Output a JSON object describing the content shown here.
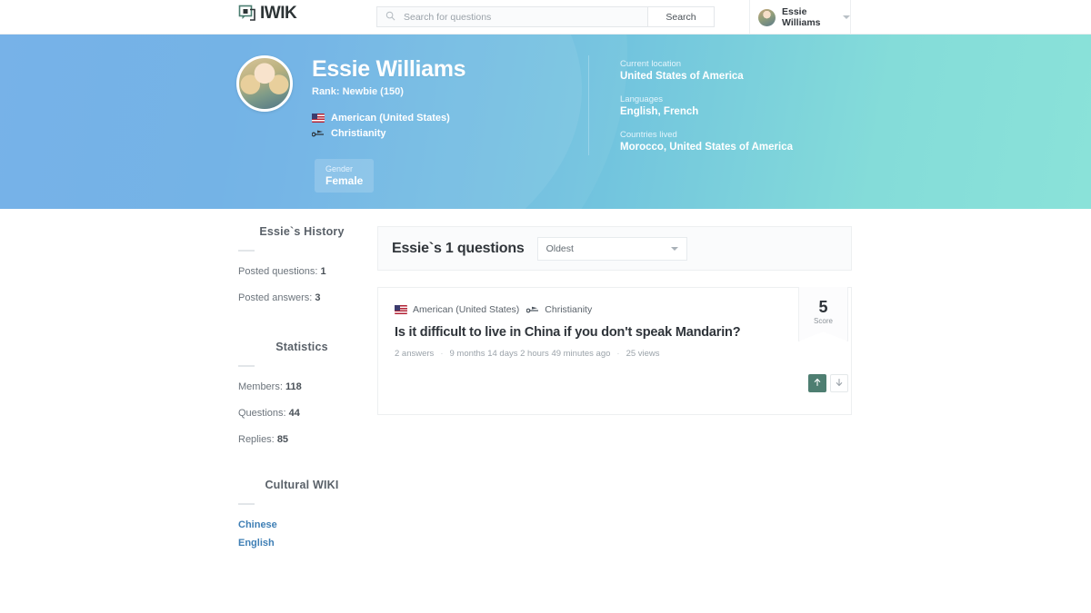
{
  "header": {
    "logo_text": "IWIK",
    "logo_icon": "speech-bubble-icon",
    "search_placeholder": "Search for questions",
    "search_value": "",
    "search_button": "Search",
    "search_icon": "search-icon",
    "user_name": "Essie Williams",
    "user_caret": "chevron-down-icon"
  },
  "hero": {
    "name": "Essie Williams",
    "rank": "Rank: Newbie (150)",
    "nationality": "American (United States)",
    "nationality_icon": "us-flag-icon",
    "religion": "Christianity",
    "religion_icon": "flag-icon",
    "gender_label": "Gender",
    "gender_value": "Female",
    "fields": [
      {
        "label": "Current location",
        "value": "United States of America"
      },
      {
        "label": "Languages",
        "value": "English, French"
      },
      {
        "label": "Countries lived",
        "value": "Morocco, United States of America"
      }
    ],
    "gradient_from": "#66a8e6",
    "gradient_to": "#8ae2d9"
  },
  "sidebar": {
    "history_heading": "Essie`s History",
    "history_items": [
      {
        "label": "Posted questions:",
        "value": "1"
      },
      {
        "label": "Posted answers:",
        "value": "3"
      }
    ],
    "statistics_heading": "Statistics",
    "statistics_items": [
      {
        "label": "Members:",
        "value": "118"
      },
      {
        "label": "Questions:",
        "value": "44"
      },
      {
        "label": "Replies:",
        "value": "85"
      }
    ],
    "wiki_heading": "Cultural WIKI",
    "wiki_links": [
      "Chinese",
      "English"
    ],
    "link_color": "#3f7fb5"
  },
  "main": {
    "title": "Essie`s 1 questions",
    "sort_value": "Oldest",
    "question": {
      "nationality": "American (United States)",
      "religion": "Christianity",
      "title": "Is it difficult to live in China if you don't speak Mandarin?",
      "answers": "2 answers",
      "time": "9 months 14 days 2 hours 49 minutes ago",
      "views": "25 views",
      "score": "5",
      "score_label": "Score",
      "upvote_icon": "arrow-up-icon",
      "downvote_icon": "arrow-down-icon",
      "upvote_color": "#4e7e71"
    }
  }
}
